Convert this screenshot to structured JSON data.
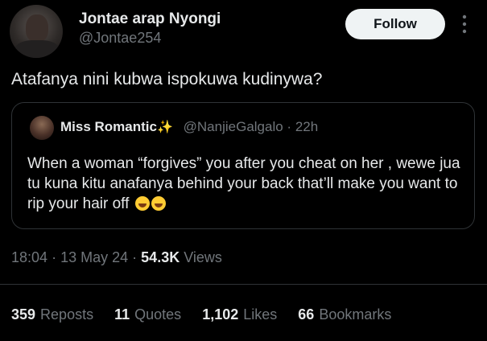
{
  "author": {
    "display_name": "Jontae arap Nyongi",
    "handle": "@Jontae254"
  },
  "follow_label": "Follow",
  "tweet": {
    "text": "Atafanya nini kubwa ispokuwa kudinywa?"
  },
  "quoted": {
    "name": "Miss Romantic",
    "handle": "@NanjieGalgalo",
    "separator": "·",
    "time": "22h",
    "text": "When a woman “forgives” you after you cheat on her , wewe jua tu kuna kitu anafanya behind your back that’ll make you want to rip your hair off"
  },
  "meta": {
    "time": "18:04",
    "sep1": "·",
    "date": "13 May 24",
    "sep2": "·",
    "views_count": "54.3K",
    "views_label": "Views"
  },
  "stats": [
    {
      "count": "359",
      "label": "Reposts"
    },
    {
      "count": "11",
      "label": "Quotes"
    },
    {
      "count": "1,102",
      "label": "Likes"
    },
    {
      "count": "66",
      "label": "Bookmarks"
    }
  ],
  "icons": {
    "more": "more-vertical-icon",
    "sparkle": "sparkles-icon",
    "emoji": "grinning-sweat-face-icon"
  },
  "colors": {
    "background": "#000000",
    "primary_text": "#e7e9ea",
    "secondary_text": "#71767b",
    "border": "#2f3336",
    "follow_bg": "#eff3f4"
  }
}
